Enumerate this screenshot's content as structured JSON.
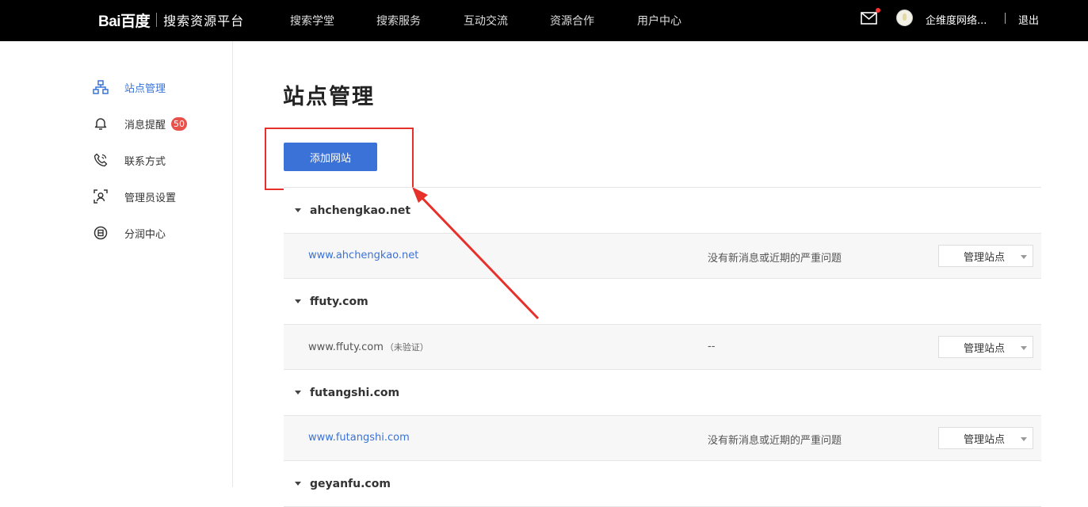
{
  "header": {
    "logo_mark": "Bai百度",
    "logo_text": "搜索资源平台",
    "nav": [
      "搜索学堂",
      "搜索服务",
      "互动交流",
      "资源合作",
      "用户中心"
    ],
    "username": "企维度网络...",
    "logout": "退出",
    "icons": {
      "mail": "mail-icon",
      "avatar": "avatar"
    }
  },
  "sidebar": {
    "items": [
      {
        "label": "站点管理",
        "icon": "sitemap-icon",
        "active": true
      },
      {
        "label": "消息提醒",
        "icon": "bell-icon",
        "badge": "50"
      },
      {
        "label": "联系方式",
        "icon": "phone-icon"
      },
      {
        "label": "管理员设置",
        "icon": "admin-icon"
      },
      {
        "label": "分润中心",
        "icon": "profit-icon"
      }
    ]
  },
  "main": {
    "title": "站点管理",
    "add_button": "添加网站",
    "manage_label": "管理站点",
    "groups": [
      {
        "domain": "ahchengkao.net",
        "site": "www.ahchengkao.net",
        "note": "",
        "status": "没有新消息或近期的严重问题",
        "verified": true
      },
      {
        "domain": "ffuty.com",
        "site": "www.ffuty.com",
        "note": "（未验证）",
        "status": "--",
        "verified": false
      },
      {
        "domain": "futangshi.com",
        "site": "www.futangshi.com",
        "note": "",
        "status": "没有新消息或近期的严重问题",
        "verified": true
      },
      {
        "domain": "geyanfu.com"
      }
    ]
  },
  "colors": {
    "accent": "#3a72d8",
    "topbar": "#000000",
    "annotation": "#e8302a",
    "badge": "#e9524a"
  }
}
